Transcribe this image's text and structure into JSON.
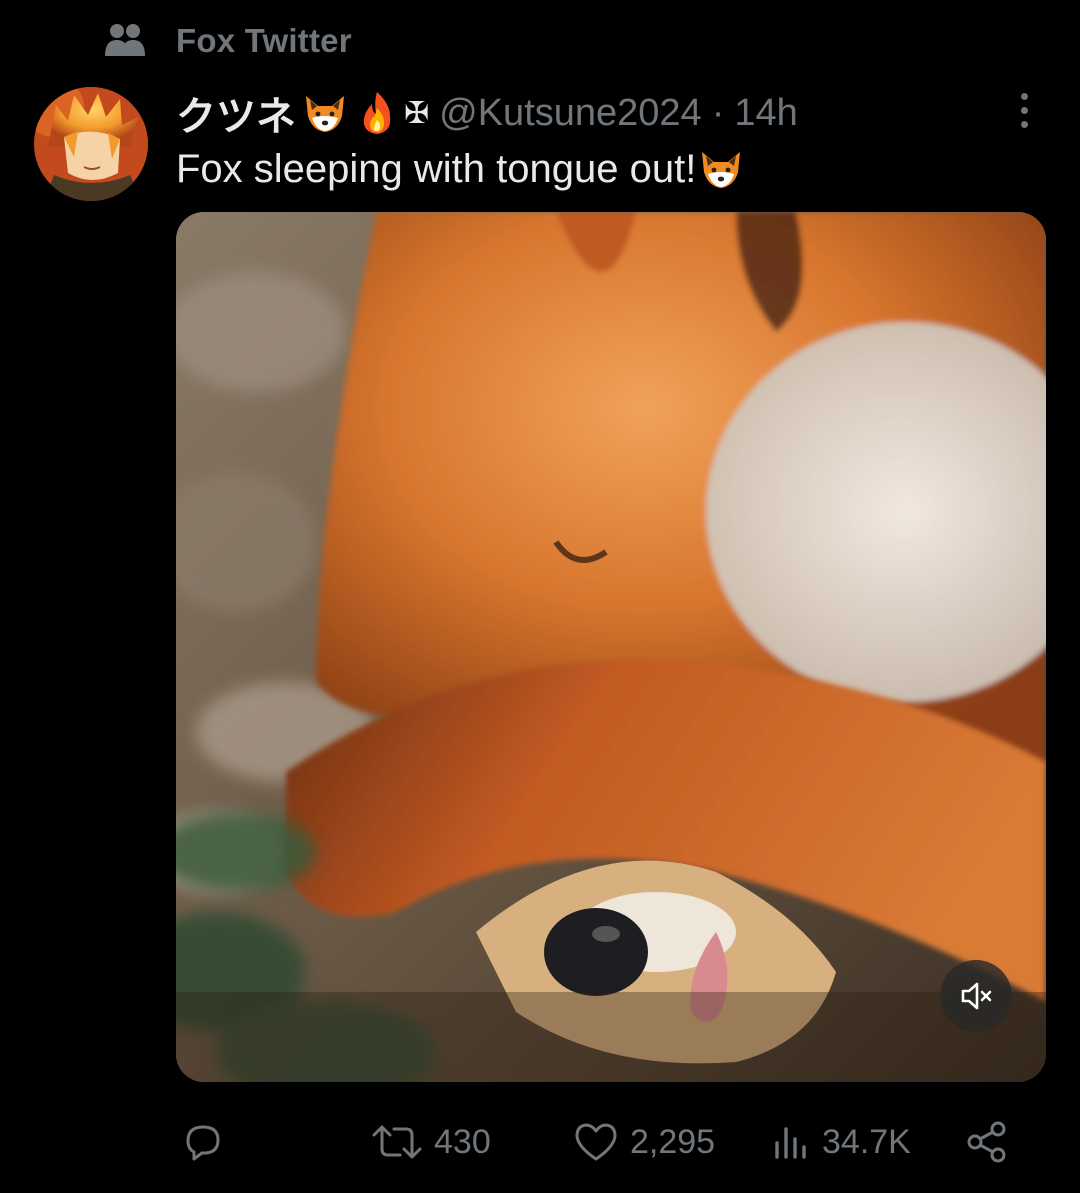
{
  "community": {
    "name": "Fox Twitter",
    "icon": "community-icon"
  },
  "tweet": {
    "display_name": "クツネ",
    "name_emojis": [
      "fox-emoji",
      "fire-emoji",
      "cross-symbol"
    ],
    "cross_symbol": "✠",
    "handle": "@Kutsune2024",
    "separator": "·",
    "time": "14h",
    "text": "Fox sleeping with tongue out!",
    "text_emoji": "fox-emoji"
  },
  "media": {
    "type": "video",
    "subject": "sleeping red fox",
    "mute_icon": "speaker-muted-icon"
  },
  "actions": {
    "reply_count": "",
    "retweet_count": "430",
    "like_count": "2,295",
    "views_count": "34.7K"
  },
  "colors": {
    "background": "#000000",
    "text_primary": "#e7e9ea",
    "text_secondary": "#71767b"
  }
}
